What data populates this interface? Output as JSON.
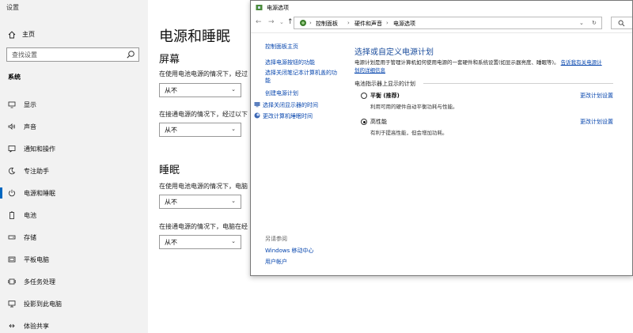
{
  "settings": {
    "app_title": "设置",
    "home_label": "主页",
    "search_placeholder": "查找设置",
    "section_label": "系统",
    "nav_items": [
      {
        "label": "显示",
        "icon": "display-icon"
      },
      {
        "label": "声音",
        "icon": "speaker-icon"
      },
      {
        "label": "通知和操作",
        "icon": "notification-icon"
      },
      {
        "label": "专注助手",
        "icon": "moon-icon"
      },
      {
        "label": "电源和睡眠",
        "icon": "power-icon"
      },
      {
        "label": "电池",
        "icon": "battery-icon"
      },
      {
        "label": "存储",
        "icon": "storage-icon"
      },
      {
        "label": "平板电脑",
        "icon": "tablet-icon"
      },
      {
        "label": "多任务处理",
        "icon": "multitask-icon"
      },
      {
        "label": "投影到此电脑",
        "icon": "projection-icon"
      },
      {
        "label": "体验共享",
        "icon": "share-icon"
      }
    ],
    "page_title": "电源和睡眠",
    "screen": {
      "heading": "屏幕",
      "battery_desc": "在使用电池电源的情况下，经过",
      "battery_value": "从不",
      "plugged_desc": "在接通电源的情况下，经过以下",
      "plugged_value": "从不"
    },
    "sleep": {
      "heading": "睡眠",
      "battery_desc": "在使用电池电源的情况下，电脑",
      "battery_value": "从不",
      "plugged_desc": "在接通电源的情况下，电脑在经",
      "plugged_value": "从不"
    }
  },
  "dialog": {
    "title": "电源选项",
    "breadcrumbs": [
      "控制面板",
      "硬件和声音",
      "电源选项"
    ],
    "left_links": [
      {
        "label": "控制面板主页"
      },
      {
        "label": "选择电源按钮的功能"
      },
      {
        "label": "选择关闭笔记本计算机盖的功"
      },
      {
        "label": "能"
      },
      {
        "label": "创建电源计划"
      },
      {
        "label": "选择关闭显示器的时间"
      },
      {
        "label": "更改计算机睡眠时间"
      }
    ],
    "see_also_label": "另请参阅",
    "see_also_links": [
      "Windows 移动中心",
      "用户帐户"
    ],
    "heading": "选择或自定义电源计划",
    "desc_text": "电源计划是用于管理计算机如何使用电源的一套硬件和系统设置(如显示器亮度、睡眠等)。",
    "desc_link": "告诉我有关电源计",
    "desc_link2": "划的详细信息",
    "group_label": "电池指示器上显示的计划",
    "plans": [
      {
        "name": "平衡 (推荐)",
        "desc": "利用可用的硬件自动平衡功耗与性能。",
        "change": "更改计划设置",
        "checked": false
      },
      {
        "name": "高性能",
        "desc": "有利于提高性能，但会增加功耗。",
        "change": "更改计划设置",
        "checked": true
      }
    ]
  },
  "colors": {
    "accent": "#0067c0",
    "link": "#0645ad",
    "heading_blue": "#1a4c9c"
  }
}
